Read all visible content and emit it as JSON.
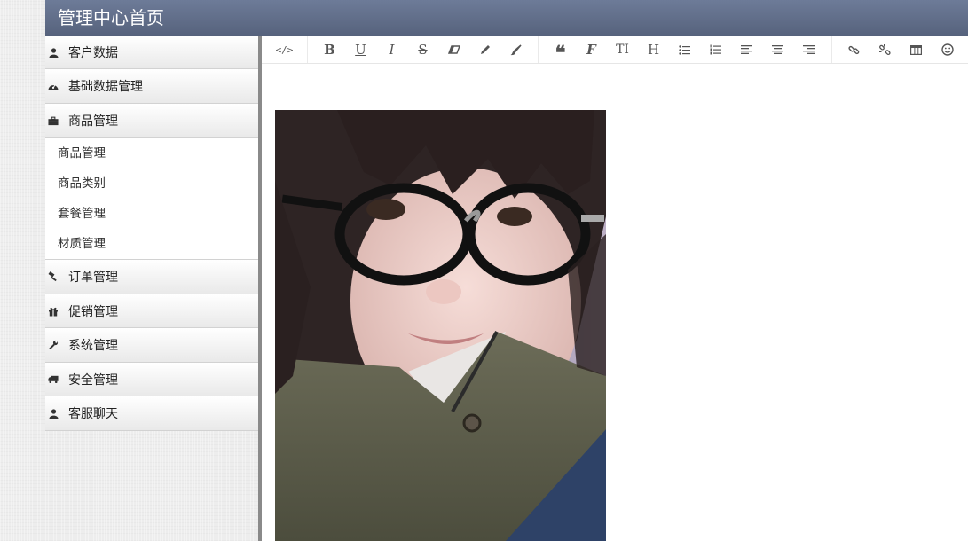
{
  "header": {
    "title": "管理中心首页"
  },
  "sidebar": {
    "items": [
      {
        "label": "客户数据",
        "icon": "user-icon"
      },
      {
        "label": "基础数据管理",
        "icon": "dashboard-icon"
      },
      {
        "label": "商品管理",
        "icon": "briefcase-icon"
      },
      {
        "label": "订单管理",
        "icon": "gavel-icon"
      },
      {
        "label": "促销管理",
        "icon": "gift-icon"
      },
      {
        "label": "系统管理",
        "icon": "wrench-icon"
      },
      {
        "label": "安全管理",
        "icon": "truck-icon"
      },
      {
        "label": "客服聊天",
        "icon": "user-icon"
      }
    ],
    "submenu": [
      "商品管理",
      "商品类别",
      "套餐管理",
      "材质管理"
    ]
  },
  "toolbar": {
    "buttons": [
      {
        "icon": "code-icon",
        "glyph": "</>"
      },
      {
        "icon": "bold-icon",
        "glyph": "B"
      },
      {
        "icon": "underline-icon",
        "glyph": "U"
      },
      {
        "icon": "italic-icon",
        "glyph": "I"
      },
      {
        "icon": "strikethrough-icon",
        "glyph": "S"
      },
      {
        "icon": "eraser-icon",
        "glyph": "⌫"
      },
      {
        "icon": "pencil-icon",
        "glyph": "✎"
      },
      {
        "icon": "brush-icon",
        "glyph": "🖌"
      },
      {
        "icon": "quote-icon",
        "glyph": "❝"
      },
      {
        "icon": "font-icon",
        "glyph": "F"
      },
      {
        "icon": "text-height-icon",
        "glyph": "TI"
      },
      {
        "icon": "heading-icon",
        "glyph": "H"
      },
      {
        "icon": "unordered-list-icon",
        "glyph": "☰"
      },
      {
        "icon": "ordered-list-icon",
        "glyph": "☷"
      },
      {
        "icon": "align-left-icon",
        "glyph": "≡"
      },
      {
        "icon": "align-center-icon",
        "glyph": "≡"
      },
      {
        "icon": "align-right-icon",
        "glyph": "≡"
      },
      {
        "icon": "link-icon",
        "glyph": "🔗"
      },
      {
        "icon": "unlink-icon",
        "glyph": "⛓"
      },
      {
        "icon": "table-icon",
        "glyph": "▦"
      },
      {
        "icon": "smile-icon",
        "glyph": "☺"
      }
    ]
  },
  "colors": {
    "header_bg": "#5f6c88",
    "sidebar_divider": "#8a8a8a",
    "editor_bg": "#ffffff"
  }
}
